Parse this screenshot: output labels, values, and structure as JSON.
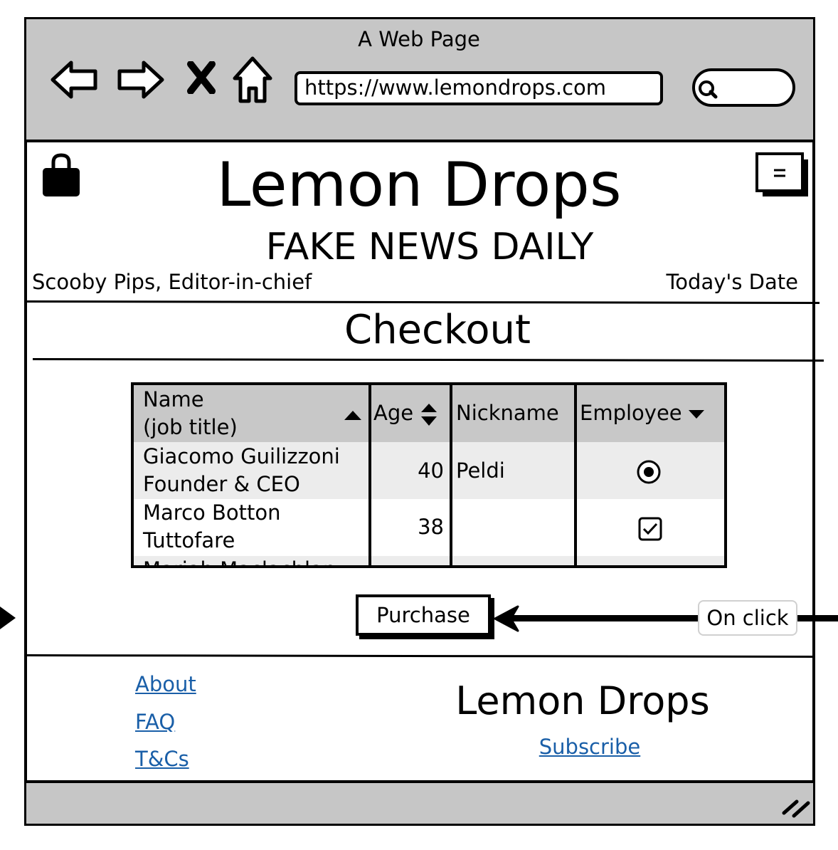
{
  "window": {
    "title": "A Web Page"
  },
  "toolbar": {
    "url": "https://www.lemondrops.com",
    "icons": [
      "back-arrow-icon",
      "forward-arrow-icon",
      "stop-icon",
      "home-icon",
      "search-icon"
    ]
  },
  "header": {
    "site_title": "Lemon Drops",
    "subtitle": "FAKE NEWS DAILY",
    "editor": "Scooby Pips, Editor-in-chief",
    "date": "Today's Date",
    "icons": [
      "shopping-bag-icon",
      "menu-icon"
    ]
  },
  "page": {
    "heading": "Checkout"
  },
  "table": {
    "headers": {
      "name_line1": "Name",
      "name_line2": "(job title)",
      "age": "Age",
      "nickname": "Nickname",
      "employee": "Employee"
    },
    "rows": [
      {
        "name": "Giacomo Guilizzoni",
        "title": "Founder & CEO",
        "age": "40",
        "nickname": "Peldi",
        "employee_control": "radio-selected"
      },
      {
        "name": "Marco Botton",
        "title": "Tuttofare",
        "age": "38",
        "nickname": "",
        "employee_control": "checkbox-checked"
      },
      {
        "name": "Mariah Maclachlan",
        "title": "",
        "age": "",
        "nickname": "",
        "employee_control": ""
      }
    ]
  },
  "actions": {
    "purchase_label": "Purchase",
    "annotation_label": "On click"
  },
  "footer": {
    "links": [
      "About",
      "FAQ",
      "T&Cs"
    ],
    "title": "Lemon Drops",
    "subscribe": "Subscribe"
  },
  "colors": {
    "chrome_gray": "#c6c6c6",
    "header_gray": "#c8c8c8",
    "row_gray": "#ececec",
    "link_blue": "#1a5fa8"
  }
}
